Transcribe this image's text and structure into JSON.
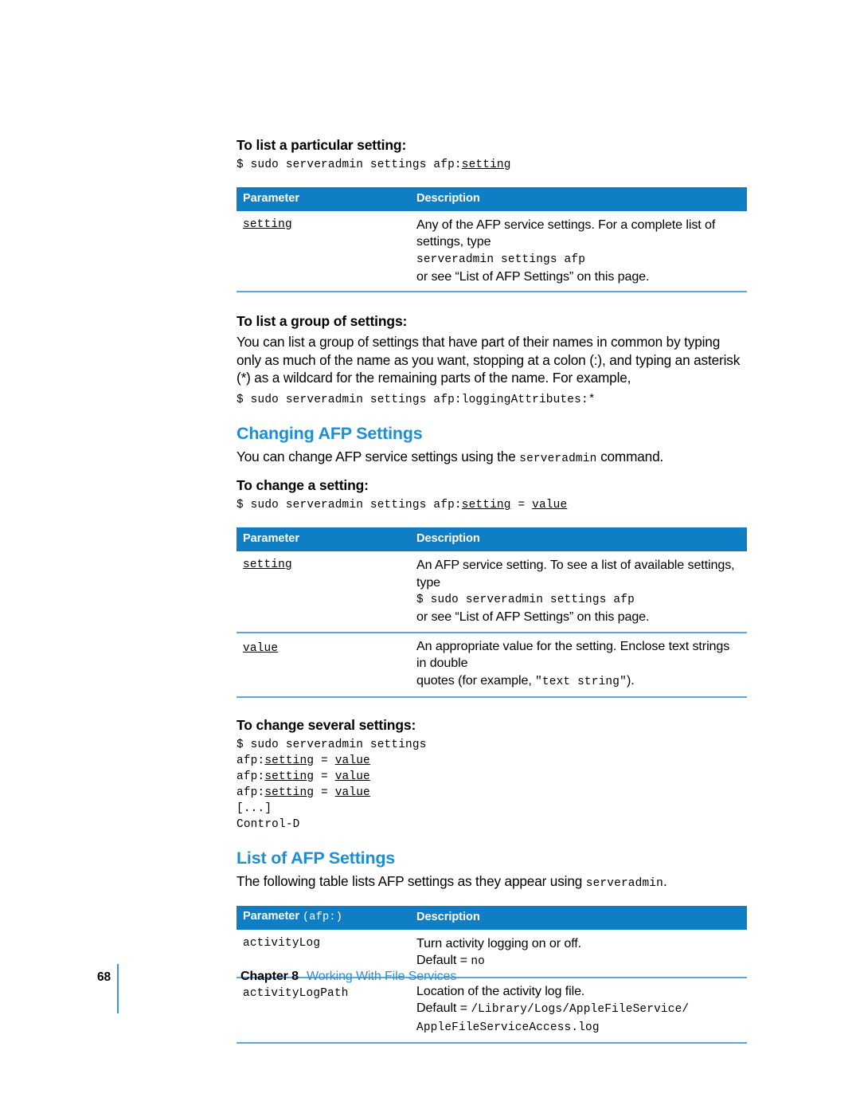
{
  "colors": {
    "heading_blue": "#1b8ed4",
    "table_header_blue": "#0f7ec4",
    "rule_blue": "#5ba6dd",
    "footer_link_blue": "#2e8fd1"
  },
  "sections": {
    "list_particular": {
      "heading": "To list a particular setting:",
      "code": "$ sudo serveradmin settings afp:",
      "code_underlined": "setting"
    },
    "list_group": {
      "heading": "To list a group of settings:",
      "paragraph": "You can list a group of settings that have part of their names in common by typing only as much of the name as you want, stopping at a colon (:), and typing an asterisk (*) as a wildcard for the remaining parts of the name. For example,",
      "code": "$ sudo serveradmin settings afp:loggingAttributes:*"
    },
    "changing_afp": {
      "heading": "Changing AFP Settings",
      "paragraph_before": "You can change AFP service settings using the ",
      "paragraph_mono": "serveradmin",
      "paragraph_after": " command."
    },
    "change_setting": {
      "heading": "To change a setting:",
      "code_p1": "$ sudo serveradmin settings afp:",
      "code_u1": "setting",
      "code_p2": " = ",
      "code_u2": "value"
    },
    "change_several": {
      "heading": "To change several settings:",
      "lines": [
        {
          "plain": "$ sudo serveradmin settings"
        },
        {
          "prefix": "afp:",
          "u1": "setting",
          "mid": " = ",
          "u2": "value"
        },
        {
          "prefix": "afp:",
          "u1": "setting",
          "mid": " = ",
          "u2": "value"
        },
        {
          "prefix": "afp:",
          "u1": "setting",
          "mid": " = ",
          "u2": "value"
        },
        {
          "plain": "[...]"
        },
        {
          "plain": "Control-D"
        }
      ]
    },
    "list_afp_settings": {
      "heading": "List of AFP Settings",
      "paragraph_before": "The following table lists AFP settings as they appear using ",
      "paragraph_mono": "serveradmin",
      "paragraph_after": "."
    }
  },
  "tables": {
    "table1": {
      "headers": {
        "col1": "Parameter",
        "col2": "Description"
      },
      "rows": [
        {
          "param": "setting",
          "param_underlined": true,
          "desc_lines": [
            {
              "text": "Any of the AFP service settings. For a complete list of settings, type",
              "mono": false
            },
            {
              "text": "serveradmin settings afp",
              "mono": true
            },
            {
              "text": "or see “List of AFP Settings” on this page.",
              "mono": false
            }
          ]
        }
      ]
    },
    "table2": {
      "headers": {
        "col1": "Parameter",
        "col2": "Description"
      },
      "rows": [
        {
          "param": "setting",
          "param_underlined": true,
          "desc_lines": [
            {
              "text": "An AFP service setting. To see a list of available settings, type",
              "mono": false
            },
            {
              "text": "$ sudo serveradmin settings afp",
              "mono": true
            },
            {
              "text": "or see “List of AFP Settings” on this page.",
              "mono": false
            }
          ]
        },
        {
          "param": "value",
          "param_underlined": true,
          "desc_lines": [
            {
              "text": "An appropriate value for the setting. Enclose text strings in double",
              "mono": false
            },
            {
              "text": "quotes (for example, \"text string\").",
              "mono": false,
              "mixed": true
            }
          ]
        }
      ]
    },
    "table3": {
      "headers": {
        "col1_label": "Parameter ",
        "col1_mono": "(afp:)",
        "col2": "Description"
      },
      "rows": [
        {
          "param": "activityLog",
          "param_underlined": false,
          "desc_lines": [
            {
              "text": "Turn activity logging on or off.",
              "mono": false
            },
            {
              "text": "Default = no",
              "mono": false,
              "mixed": true
            }
          ]
        },
        {
          "param": "activityLogPath",
          "param_underlined": false,
          "desc_lines": [
            {
              "text": "Location of the activity log file.",
              "mono": false
            },
            {
              "text": "Default = /Library/Logs/AppleFileService/",
              "mono": false,
              "mixed": true
            },
            {
              "text": "AppleFileServiceAccess.log",
              "mono": true
            }
          ]
        }
      ]
    }
  },
  "footer": {
    "page_number": "68",
    "chapter": "Chapter 8",
    "chapter_title": "Working With File Services"
  }
}
